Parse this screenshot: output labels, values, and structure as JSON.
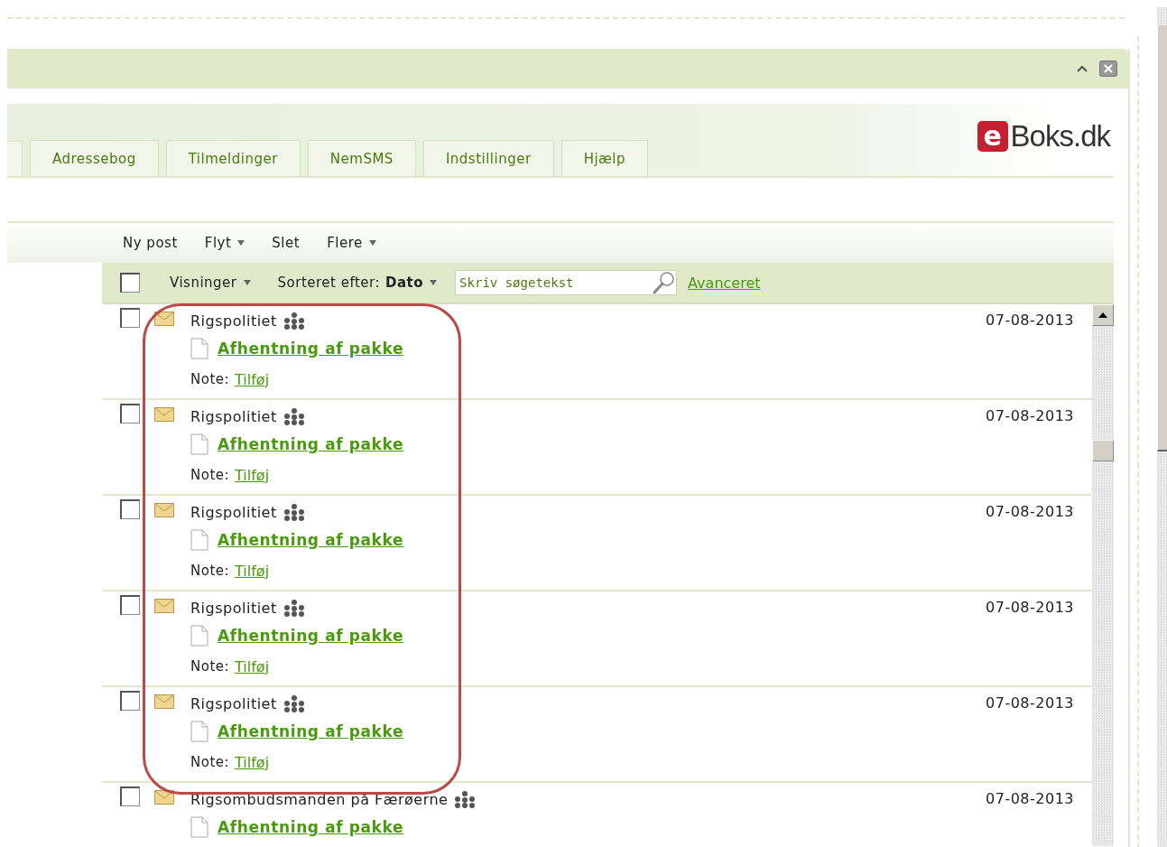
{
  "tabs": [
    {
      "label": "Adressebog",
      "selected": false
    },
    {
      "label": "Tilmeldinger",
      "selected": false
    },
    {
      "label": "NemSMS",
      "selected": false
    },
    {
      "label": "Indstillinger",
      "selected": false
    },
    {
      "label": "Hjælp",
      "selected": false
    }
  ],
  "logo": {
    "badge": "e",
    "text": "Boks.dk"
  },
  "toolbar": [
    {
      "label": "Ny post",
      "dropdown": false
    },
    {
      "label": "Flyt",
      "dropdown": true
    },
    {
      "label": "Slet",
      "dropdown": false
    },
    {
      "label": "Flere",
      "dropdown": true
    }
  ],
  "list_header": {
    "select_all_checked": false,
    "views": "Visninger",
    "sort_label": "Sorteret efter:",
    "sort_value": "Dato",
    "search": {
      "placeholder": "Skriv søgetekst"
    },
    "advanced": "Avanceret"
  },
  "messages": [
    {
      "checked": false,
      "sender": "Rigspolitiet",
      "subject": "Afhentning af pakke",
      "note_label": "Note:",
      "note_link": "Tilføj",
      "date": "07-08-2013"
    },
    {
      "checked": false,
      "sender": "Rigspolitiet",
      "subject": "Afhentning af pakke",
      "note_label": "Note:",
      "note_link": "Tilføj",
      "date": "07-08-2013"
    },
    {
      "checked": false,
      "sender": "Rigspolitiet",
      "subject": "Afhentning af pakke",
      "note_label": "Note:",
      "note_link": "Tilføj",
      "date": "07-08-2013"
    },
    {
      "checked": false,
      "sender": "Rigspolitiet",
      "subject": "Afhentning af pakke",
      "note_label": "Note:",
      "note_link": "Tilføj",
      "date": "07-08-2013"
    },
    {
      "checked": false,
      "sender": "Rigspolitiet",
      "subject": "Afhentning af pakke",
      "note_label": "Note:",
      "note_link": "Tilføj",
      "date": "07-08-2013"
    },
    {
      "checked": false,
      "sender": "Rigsombudsmanden på Færøerne",
      "subject": "Afhentning af pakke",
      "date": "07-08-2013"
    }
  ]
}
